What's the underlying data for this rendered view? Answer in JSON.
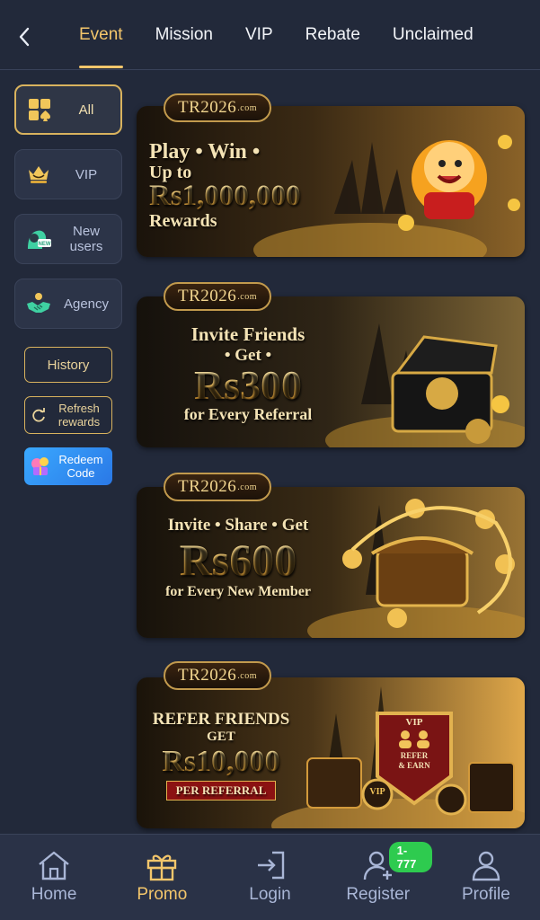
{
  "header": {
    "tabs": [
      {
        "label": "Event",
        "active": true
      },
      {
        "label": "Mission",
        "active": false
      },
      {
        "label": "VIP",
        "active": false
      },
      {
        "label": "Rebate",
        "active": false
      },
      {
        "label": "Unclaimed",
        "active": false
      }
    ]
  },
  "sidebar": {
    "categories": [
      {
        "label": "All",
        "icon": "grid-spade-icon",
        "active": true
      },
      {
        "label": "VIP",
        "icon": "crown-icon",
        "active": false
      },
      {
        "label": "New users",
        "icon": "new-user-icon",
        "active": false
      },
      {
        "label": "Agency",
        "icon": "handshake-icon",
        "active": false
      }
    ],
    "history_label": "History",
    "refresh_label": "Refresh rewards",
    "redeem_label": "Redeem Code"
  },
  "banners": [
    {
      "brand": "TR2026",
      "brand_suffix": ".com",
      "line1": "Play • Win •",
      "line2": "Up to",
      "amount": "Rs1,000,000",
      "line3": "Rewards"
    },
    {
      "brand": "TR2026",
      "brand_suffix": ".com",
      "line1": "Invite Friends",
      "line2": "• Get •",
      "amount": "Rs300",
      "line3": "for Every Referral"
    },
    {
      "brand": "TR2026",
      "brand_suffix": ".com",
      "line1": "Invite • Share • Get",
      "amount": "Rs600",
      "line3": "for Every New Member"
    },
    {
      "brand": "TR2026",
      "brand_suffix": ".com",
      "line1": "REFER FRIENDS",
      "line2": "GET",
      "amount": "Rs10,000",
      "line3": "PER REFERRAL",
      "shield_top": "VIP",
      "shield_mid": "REFER & EARN",
      "coin_label": "VIP"
    }
  ],
  "bottom_nav": {
    "items": [
      {
        "label": "Home",
        "icon": "home-icon",
        "active": false
      },
      {
        "label": "Promo",
        "icon": "gift-icon",
        "active": true
      },
      {
        "label": "Login",
        "icon": "login-icon",
        "active": false
      },
      {
        "label": "Register",
        "icon": "add-user-icon",
        "active": false
      },
      {
        "label": "Profile",
        "icon": "profile-icon",
        "active": false
      }
    ],
    "register_badge": "1-777"
  },
  "colors": {
    "background": "#22293a",
    "accent_gold": "#f3c66b",
    "badge_green": "#2ecb4f",
    "redeem_blue": "#2a78e6"
  }
}
